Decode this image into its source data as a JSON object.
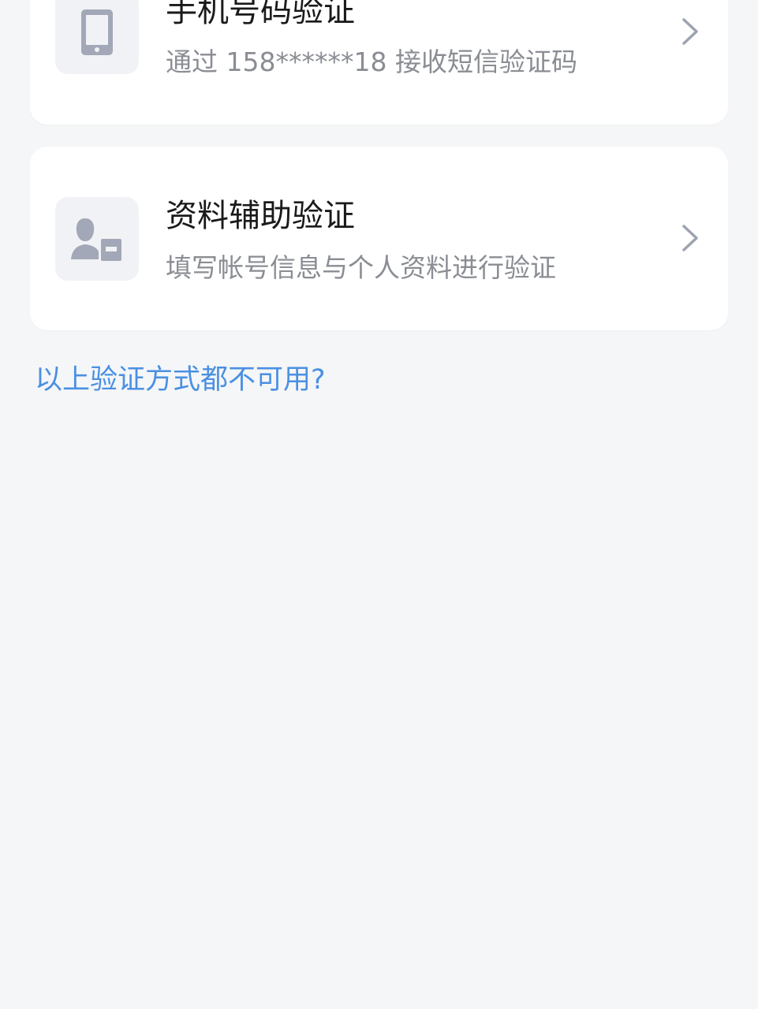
{
  "methods": [
    {
      "title": "手机号码验证",
      "subtitle": "通过 158******18 接收短信验证码",
      "icon": "phone-icon"
    },
    {
      "title": "资料辅助验证",
      "subtitle": "填写帐号信息与个人资料进行验证",
      "icon": "profile-card-icon"
    }
  ],
  "help_link": "以上验证方式都不可用?",
  "colors": {
    "background": "#f5f6f8",
    "card": "#ffffff",
    "icon_gray": "#a3a8b8",
    "link": "#4a90e2"
  }
}
